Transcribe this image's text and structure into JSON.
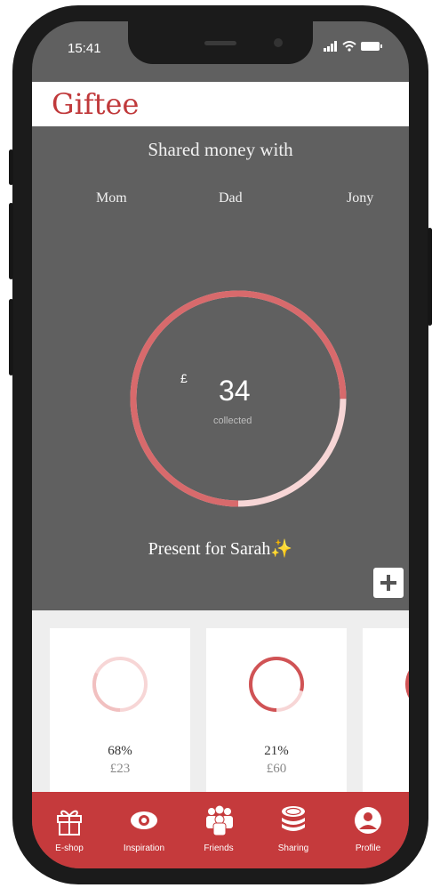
{
  "status": {
    "time": "15:41"
  },
  "app": {
    "logo": "Giftee"
  },
  "shared": {
    "title": "Shared money with",
    "people": [
      "Mom",
      "Dad",
      "Jony"
    ]
  },
  "summary": {
    "currency": "£",
    "amount": "34",
    "amount_label": "collected",
    "progress_fraction": 0.25
  },
  "present": {
    "title": "Present for Sarah✨"
  },
  "cards": [
    {
      "percent": "68%",
      "amount": "£23",
      "progress_fraction": 0.68
    },
    {
      "percent": "21%",
      "amount": "£60",
      "progress_fraction": 0.21
    }
  ],
  "nav": [
    {
      "label": "E-shop",
      "icon": "gift-icon"
    },
    {
      "label": "Inspiration",
      "icon": "eye-icon"
    },
    {
      "label": "Friends",
      "icon": "friends-icon"
    },
    {
      "label": "Sharing",
      "icon": "coins-icon"
    },
    {
      "label": "Profile",
      "icon": "profile-icon"
    }
  ],
  "colors": {
    "brand_red": "#c53a3c",
    "ring_filled": "#d86a6c",
    "ring_light": "#f7d6d6",
    "screen_bg": "#606060"
  }
}
